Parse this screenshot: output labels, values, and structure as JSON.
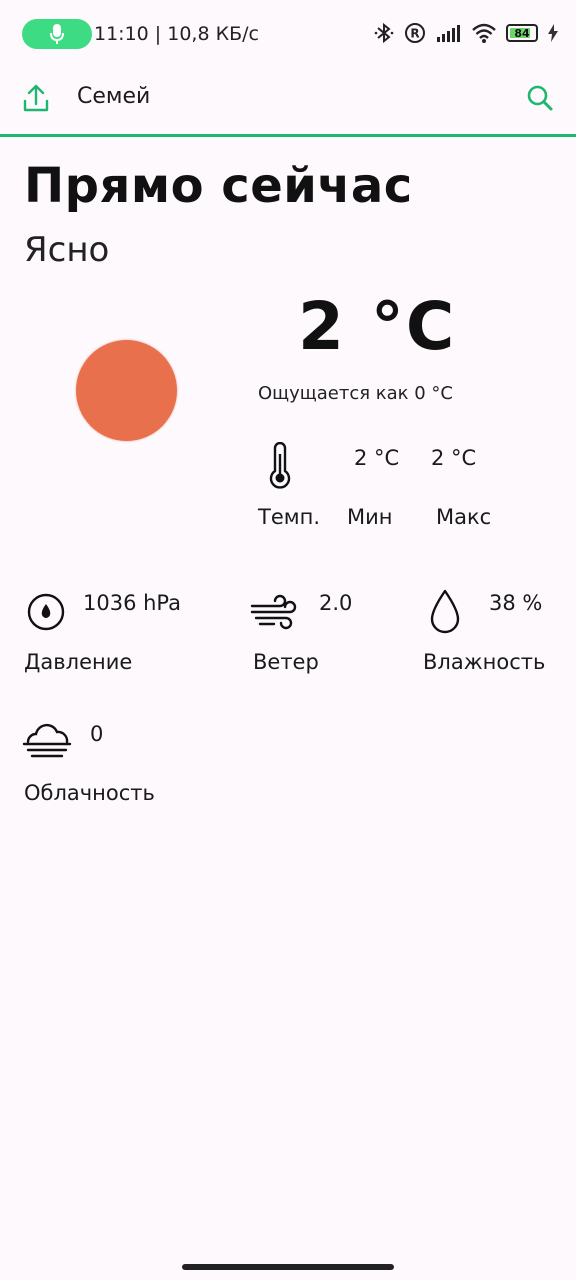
{
  "status_bar": {
    "time_speed": "11:10 | 10,8 КБ/с",
    "battery_level": "84",
    "battery_fraction": 0.84,
    "accent_mic": "#3ddc84",
    "icons": [
      "bluetooth-icon",
      "registered-icon",
      "signal-icon",
      "wifi-icon",
      "battery-icon",
      "charging-icon"
    ]
  },
  "app_bar": {
    "title": "Семей",
    "share_icon": "share-icon",
    "search_icon": "search-icon",
    "accent": "#1fb66f"
  },
  "main": {
    "heading": "Прямо сейчас",
    "condition": "Ясно",
    "sun_color": "#e8704c",
    "temperature": "2 °C",
    "feels_like": "Ощущается как 0 °C",
    "temp_min": "2 °C",
    "temp_max": "2 °C",
    "label_temp": "Темп.",
    "label_min": "Мин",
    "label_max": "Макс"
  },
  "metrics": {
    "pressure": {
      "value": "1036 hPa",
      "label": "Давление"
    },
    "wind": {
      "value": "2.0",
      "label": "Ветер"
    },
    "humidity": {
      "value": "38 %",
      "label": "Влажность"
    },
    "cloudiness": {
      "value": "0",
      "label": "Облачность"
    }
  }
}
